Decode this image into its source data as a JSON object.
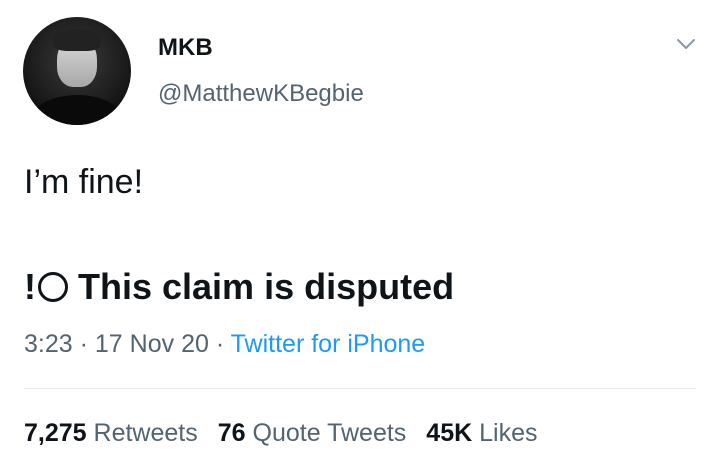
{
  "author": {
    "display_name": "MKB",
    "handle": "@MatthewKBegbie"
  },
  "tweet": {
    "text": "I’m fine!",
    "claim_prefix": "!",
    "claim_label": "This claim is disputed",
    "time": "3:23",
    "date": "17 Nov 20",
    "separator": "·",
    "source": "Twitter for iPhone"
  },
  "stats": {
    "retweets_count": "7,275",
    "retweets_label": "Retweets",
    "quote_count": "76",
    "quote_label": "Quote Tweets",
    "likes_count": "45K",
    "likes_label": "Likes"
  },
  "icons": {
    "avatar": "avatar",
    "menu": "chevron-down-icon",
    "claim": "circle-icon"
  },
  "colors": {
    "text": "#0f1419",
    "muted": "#536471",
    "link": "#1d9bf0",
    "divider": "#e6ecf0"
  }
}
